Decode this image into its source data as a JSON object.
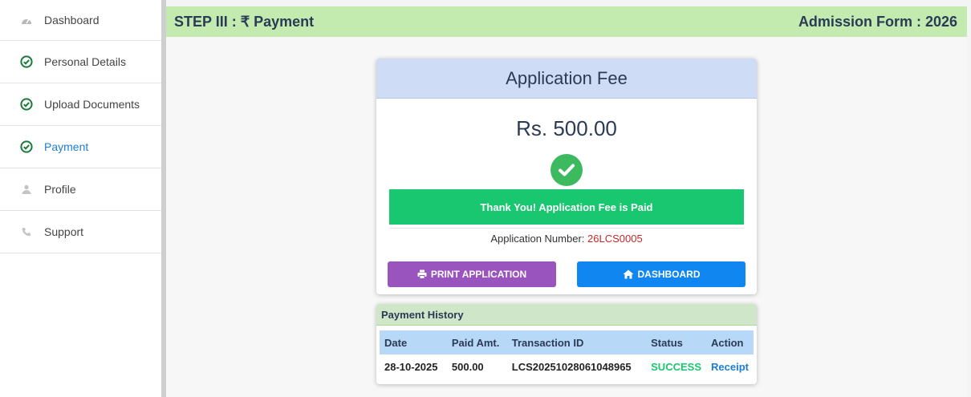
{
  "sidebar": {
    "items": [
      {
        "label": "Dashboard",
        "icon": "dashboard-icon",
        "active": false
      },
      {
        "label": "Personal Details",
        "icon": "check-circle-icon",
        "active": false
      },
      {
        "label": "Upload Documents",
        "icon": "check-circle-icon",
        "active": false
      },
      {
        "label": "Payment",
        "icon": "check-circle-icon",
        "active": true
      },
      {
        "label": "Profile",
        "icon": "user-icon",
        "active": false
      },
      {
        "label": "Support",
        "icon": "phone-icon",
        "active": false
      }
    ]
  },
  "header": {
    "step_title": "STEP III : ₹ Payment",
    "form_title": "Admission Form : 2026"
  },
  "fee_card": {
    "title": "Application Fee",
    "amount": "Rs. 500.00",
    "paid_message": "Thank You! Application Fee is Paid",
    "app_number_label": "Application Number: ",
    "app_number": "26LCS0005",
    "print_button": "PRINT APPLICATION",
    "dashboard_button": "DASHBOARD"
  },
  "history": {
    "title": "Payment History",
    "columns": [
      "Date",
      "Paid Amt.",
      "Transaction ID",
      "Status",
      "Action"
    ],
    "rows": [
      {
        "date": "28-10-2025",
        "amount": "500.00",
        "txn": "LCS20251028061048965",
        "status": "SUCCESS",
        "action": "Receipt"
      }
    ]
  },
  "colors": {
    "header_bg": "#c3ebb0",
    "success": "#19c770",
    "print_btn": "#9a54bd",
    "dashboard_btn": "#0f86f0",
    "active_link": "#1b7ed6"
  }
}
